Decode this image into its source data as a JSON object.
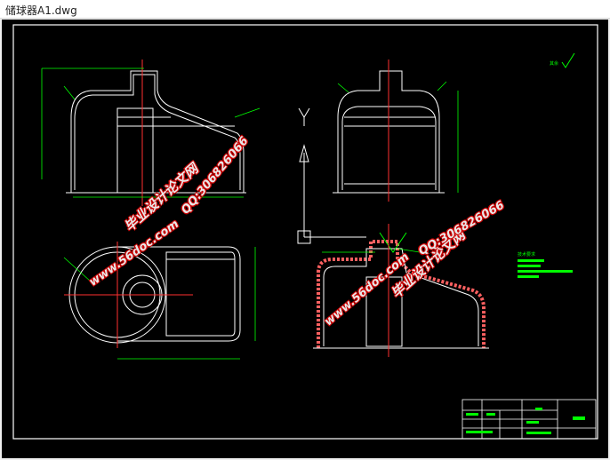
{
  "window": {
    "title": "储球器A1.dwg"
  },
  "watermarks": {
    "brand": "毕业设计论文网",
    "site": "www.56doc.com",
    "qq": "QQ:306826066"
  },
  "drawing": {
    "axis_y_label": "Y",
    "roughness_mark": "其余",
    "tech_req_title": "技术要求"
  },
  "colors": {
    "outline": "#ffffff",
    "dimension": "#00ff00",
    "centerline": "#ff3030",
    "section": "#ff6060",
    "frame": "#ffffff"
  }
}
